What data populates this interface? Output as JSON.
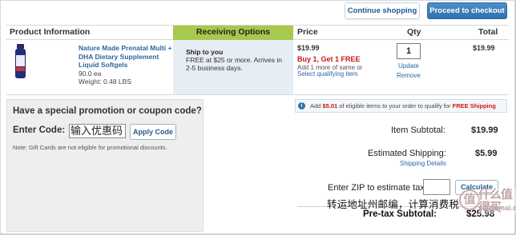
{
  "top_buttons": {
    "continue_shopping": "Continue shopping",
    "checkout": "Proceed to checkout"
  },
  "table": {
    "headers": {
      "product": "Product Information",
      "receiving": "Receiving Options",
      "price": "Price",
      "qty": "Qty",
      "total": "Total"
    },
    "item": {
      "name": "Nature Made Prenatal Multi + DHA Dietary Supplement Liquid Softgels",
      "each": "90.0 ea",
      "weight": "Weight: 0.48 LBS",
      "ship_title": "Ship to you",
      "ship_text": "FREE at $25 or more. Arrives in 2-5 business days.",
      "price": "$19.99",
      "promo": "Buy 1, Get 1 FREE",
      "promo_sub": "Add 1 more of same or",
      "promo_link": "Select qualifying item",
      "qty": "1",
      "update": "Update",
      "remove": "Remove",
      "total": "$19.99"
    }
  },
  "coupon": {
    "title": "Have a special promotion or coupon code?",
    "enter_label": "Enter Code:",
    "input_value": "输入优惠码",
    "apply": "Apply Code",
    "note": "Note: Gift Cards are not eligible for promotional discounts."
  },
  "free_shipping_banner": {
    "pre": "Add ",
    "amount": "$5.01",
    "mid": " of eligible items to your order to qualify for ",
    "free": "FREE Shipping"
  },
  "summary": {
    "subtotal_label": "Item Subtotal:",
    "subtotal_value": "$19.99",
    "shipping_label": "Estimated Shipping:",
    "shipping_value": "$5.99",
    "shipping_details": "Shipping Details",
    "zip_label": "Enter ZIP to estimate tax:",
    "calculate": "Calculate",
    "overlay_note": "转运地址州邮编，计算消费税",
    "pretax_label": "Pre-tax Subtotal:",
    "pretax_value": "$25.98"
  },
  "watermark": {
    "glyph": "值",
    "title": "什么值得买",
    "url": "zdizhimai.com"
  },
  "colors": {
    "link": "#2d67a1",
    "checkout_button": "#2f72ad",
    "receiving_header": "#a7c94d",
    "promo_red": "#cc1616"
  }
}
